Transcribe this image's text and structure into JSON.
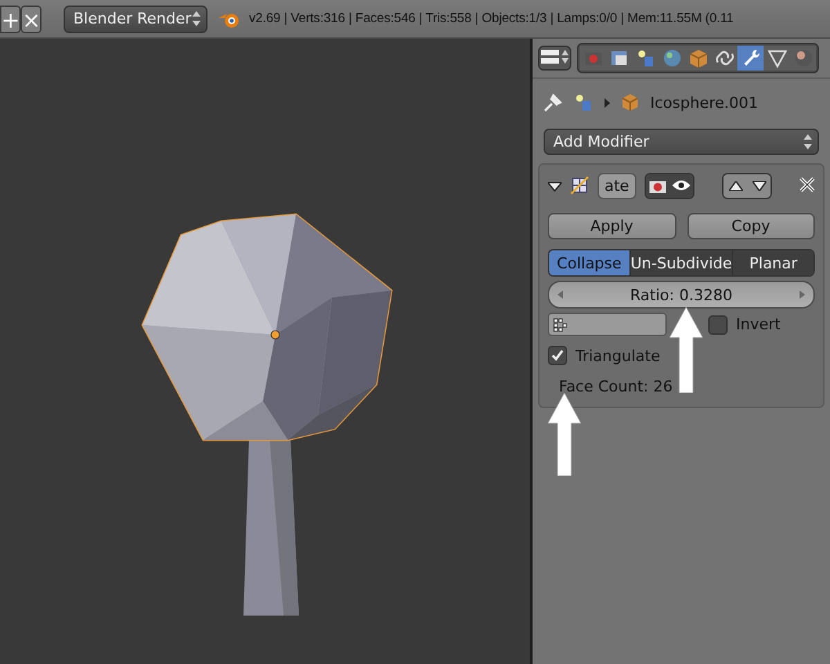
{
  "header": {
    "buttons": [
      {
        "kind": "add",
        "label": "+"
      },
      {
        "kind": "close",
        "label": "×"
      }
    ],
    "render_engine": "Blender Render",
    "stats": "v2.69 | Verts:316 | Faces:546 | Tris:558 | Objects:1/3 | Lamps:0/0 | Mem:11.55M (0.11"
  },
  "properties": {
    "context_tabs": [
      {
        "kind": "render",
        "selected": false
      },
      {
        "kind": "layers",
        "selected": false
      },
      {
        "kind": "scene",
        "selected": false
      },
      {
        "kind": "world",
        "selected": false
      },
      {
        "kind": "object",
        "selected": false
      },
      {
        "kind": "constraints",
        "selected": false
      },
      {
        "kind": "modifiers",
        "selected": true
      },
      {
        "kind": "data",
        "selected": false
      },
      {
        "kind": "material",
        "selected": false
      }
    ],
    "breadcrumb": "Icosphere.001",
    "add_modifier": "Add Modifier",
    "modifier": {
      "expanded": true,
      "name": "ate",
      "show_render": true,
      "show_viewport": true,
      "apply": "Apply",
      "copy": "Copy",
      "modes": [
        {
          "label": "Collapse",
          "selected": true
        },
        {
          "label": "Un-Subdivide",
          "selected": false
        },
        {
          "label": "Planar",
          "selected": false
        }
      ],
      "ratio": "Ratio: 0.3280",
      "invert": {
        "label": "Invert",
        "checked": false
      },
      "triangulate": {
        "label": "Triangulate",
        "checked": true
      },
      "face_count": "Face Count: 26"
    }
  }
}
